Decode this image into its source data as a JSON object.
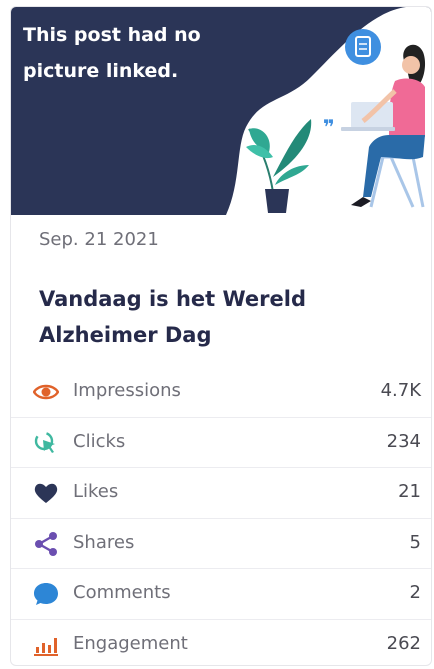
{
  "post": {
    "placeholder_text": "This post had no picture linked.",
    "date": "Sep. 21 2021",
    "title": "Vandaag is het Wereld Alzheimer Dag"
  },
  "stats": [
    {
      "label": "Impressions",
      "value": "4.7K",
      "icon": "eye-icon",
      "color": "#e0622a"
    },
    {
      "label": "Clicks",
      "value": "234",
      "icon": "cursor-click-icon",
      "color": "#3fb8a0"
    },
    {
      "label": "Likes",
      "value": "21",
      "icon": "heart-icon",
      "color": "#2c3557"
    },
    {
      "label": "Shares",
      "value": "5",
      "icon": "share-icon",
      "color": "#6b4fb0"
    },
    {
      "label": "Comments",
      "value": "2",
      "icon": "speech-bubble-icon",
      "color": "#2d86d6"
    },
    {
      "label": "Engagement",
      "value": "262",
      "icon": "bar-chart-icon",
      "color": "#e0622a"
    }
  ],
  "colors": {
    "hero_background": "#2b3557",
    "title_text": "#262a4a"
  }
}
